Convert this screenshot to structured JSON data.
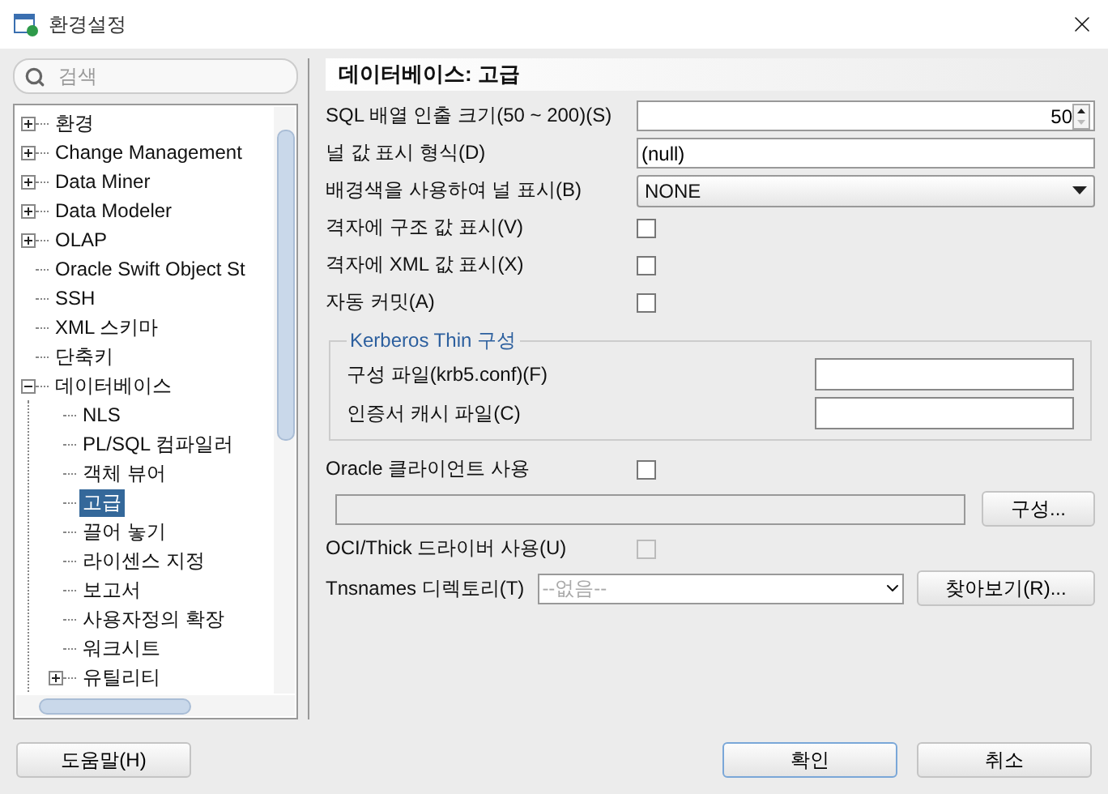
{
  "window": {
    "title": "환경설정"
  },
  "search": {
    "placeholder": "검색"
  },
  "tree": [
    {
      "label": "환경",
      "kind": "folder",
      "expanded": false,
      "selected": false
    },
    {
      "label": "Change Management",
      "kind": "folder",
      "expanded": false,
      "selected": false
    },
    {
      "label": "Data Miner",
      "kind": "folder",
      "expanded": false,
      "selected": false
    },
    {
      "label": "Data Modeler",
      "kind": "folder",
      "expanded": false,
      "selected": false
    },
    {
      "label": "OLAP",
      "kind": "folder",
      "expanded": false,
      "selected": false
    },
    {
      "label": "Oracle Swift Object St",
      "kind": "leaf",
      "selected": false
    },
    {
      "label": "SSH",
      "kind": "leaf",
      "selected": false
    },
    {
      "label": "XML 스키마",
      "kind": "leaf",
      "selected": false
    },
    {
      "label": "단축키",
      "kind": "leaf",
      "selected": false
    },
    {
      "label": "데이터베이스",
      "kind": "folder",
      "expanded": true,
      "selected": false,
      "children": [
        {
          "label": "NLS",
          "kind": "leaf",
          "selected": false
        },
        {
          "label": "PL/SQL 컴파일러",
          "kind": "leaf",
          "selected": false
        },
        {
          "label": "객체 뷰어",
          "kind": "leaf",
          "selected": false
        },
        {
          "label": "고급",
          "kind": "leaf",
          "selected": true
        },
        {
          "label": "끌어 놓기",
          "kind": "leaf",
          "selected": false
        },
        {
          "label": "라이센스 지정",
          "kind": "leaf",
          "selected": false
        },
        {
          "label": "보고서",
          "kind": "leaf",
          "selected": false
        },
        {
          "label": "사용자정의 확장",
          "kind": "leaf",
          "selected": false
        },
        {
          "label": "워크시트",
          "kind": "leaf",
          "selected": false
        },
        {
          "label": "유틸리티",
          "kind": "folder",
          "expanded": false,
          "selected": false
        }
      ]
    }
  ],
  "form": {
    "title": "데이터베이스: 고급",
    "rows": [
      {
        "kind": "spinner",
        "label": "SQL 배열 인출 크기(50 ~ 200)(S)",
        "value": "50"
      },
      {
        "kind": "text",
        "label": "널 값 표시 형식(D)",
        "value": "(null)"
      },
      {
        "kind": "dropdown",
        "label": "배경색을 사용하여 널 표시(B)",
        "value": "NONE"
      },
      {
        "kind": "checkbox",
        "label": "격자에 구조 값 표시(V)",
        "checked": false,
        "disabled": false
      },
      {
        "kind": "checkbox",
        "label": "격자에 XML 값 표시(X)",
        "checked": false,
        "disabled": false
      },
      {
        "kind": "checkbox",
        "label": "자동 커밋(A)",
        "checked": false,
        "disabled": false
      }
    ],
    "kerberos": {
      "title": "Kerberos Thin 구성",
      "fields": [
        {
          "label": "구성 파일(krb5.conf)(F)"
        },
        {
          "label": "인증서 캐시 파일(C)"
        }
      ]
    },
    "client_rows": [
      {
        "kind": "checkbox",
        "label": "Oracle 클라이언트 사용",
        "checked": false,
        "disabled": false
      },
      {
        "kind": "path",
        "button": "구성...",
        "disabled": true
      },
      {
        "kind": "checkbox",
        "label": "OCI/Thick 드라이버 사용(U)",
        "checked": false,
        "disabled": true
      },
      {
        "kind": "combo",
        "label": "Tnsnames 디렉토리(T)",
        "placeholder": "--없음--",
        "button": "찾아보기(R)..."
      }
    ]
  },
  "footer": {
    "help": "도움말(H)",
    "ok": "확인",
    "cancel": "취소"
  }
}
